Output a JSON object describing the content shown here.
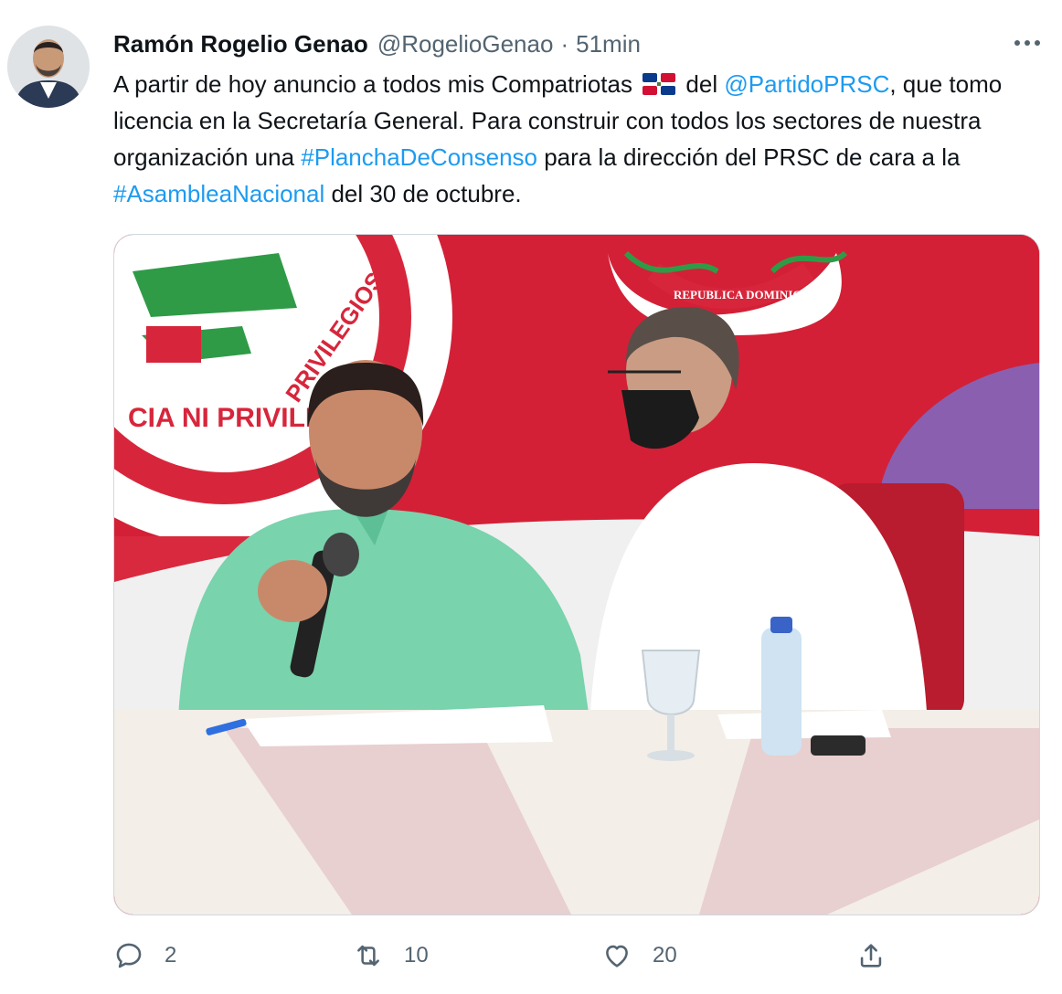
{
  "tweet": {
    "author_name": "Ramón Rogelio Genao",
    "author_handle": "@RogelioGenao",
    "separator": "·",
    "time": "51min",
    "text_parts": {
      "p1": "A partir de hoy anuncio a todos mis Compatriotas ",
      "p2": " del ",
      "mention": "@PartidoPRSC",
      "p3": ", que tomo licencia en la Secretaría General. Para construir con todos los sectores de nuestra organización una ",
      "hashtag1": "#PlanchaDeConsenso",
      "p4": " para la dirección del PRSC de cara a la ",
      "hashtag2": "#AsambleaNacional",
      "p5": " del 30 de octubre."
    },
    "media": {
      "banner_text_left": "CIA NI PRIVILEGIOS",
      "banner_text_arc": "PRIVILEGIOS",
      "banner_text_right": "REPUBLICA DOMINICANA"
    },
    "actions": {
      "reply_count": "2",
      "retweet_count": "10",
      "like_count": "20"
    }
  },
  "colors": {
    "link": "#1d9bf0",
    "secondary_text": "#536471",
    "banner_red": "#d7263b"
  },
  "icons": [
    "more-icon",
    "flag-do-icon",
    "reply-icon",
    "retweet-icon",
    "like-icon",
    "share-icon"
  ]
}
